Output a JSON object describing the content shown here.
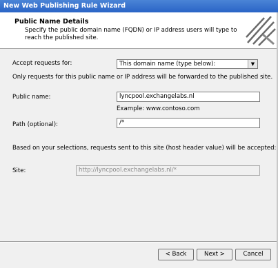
{
  "window": {
    "title": "New Web Publishing Rule Wizard"
  },
  "header": {
    "title": "Public Name Details",
    "description": "Specify the public domain name (FQDN) or IP address users will type to reach the published site."
  },
  "form": {
    "accept_label": "Accept requests for:",
    "accept_value": "This domain name (type below):",
    "info_text": "Only requests for this public name or IP address will be forwarded to the published site.",
    "public_name_label": "Public name:",
    "public_name_value": "lyncpool.exchangelabs.nl",
    "example_text": "Example: www.contoso.com",
    "path_label": "Path (optional):",
    "path_value": "/*",
    "result_text": "Based on your selections, requests sent to this site (host header value) will be accepted:",
    "site_label": "Site:",
    "site_value": "http://lyncpool.exchangelabs.nl/*"
  },
  "buttons": {
    "back": "< Back",
    "next": "Next >",
    "cancel": "Cancel"
  },
  "icons": {
    "header": "wizard-graphic-icon",
    "dropdown": "chevron-down-icon"
  }
}
